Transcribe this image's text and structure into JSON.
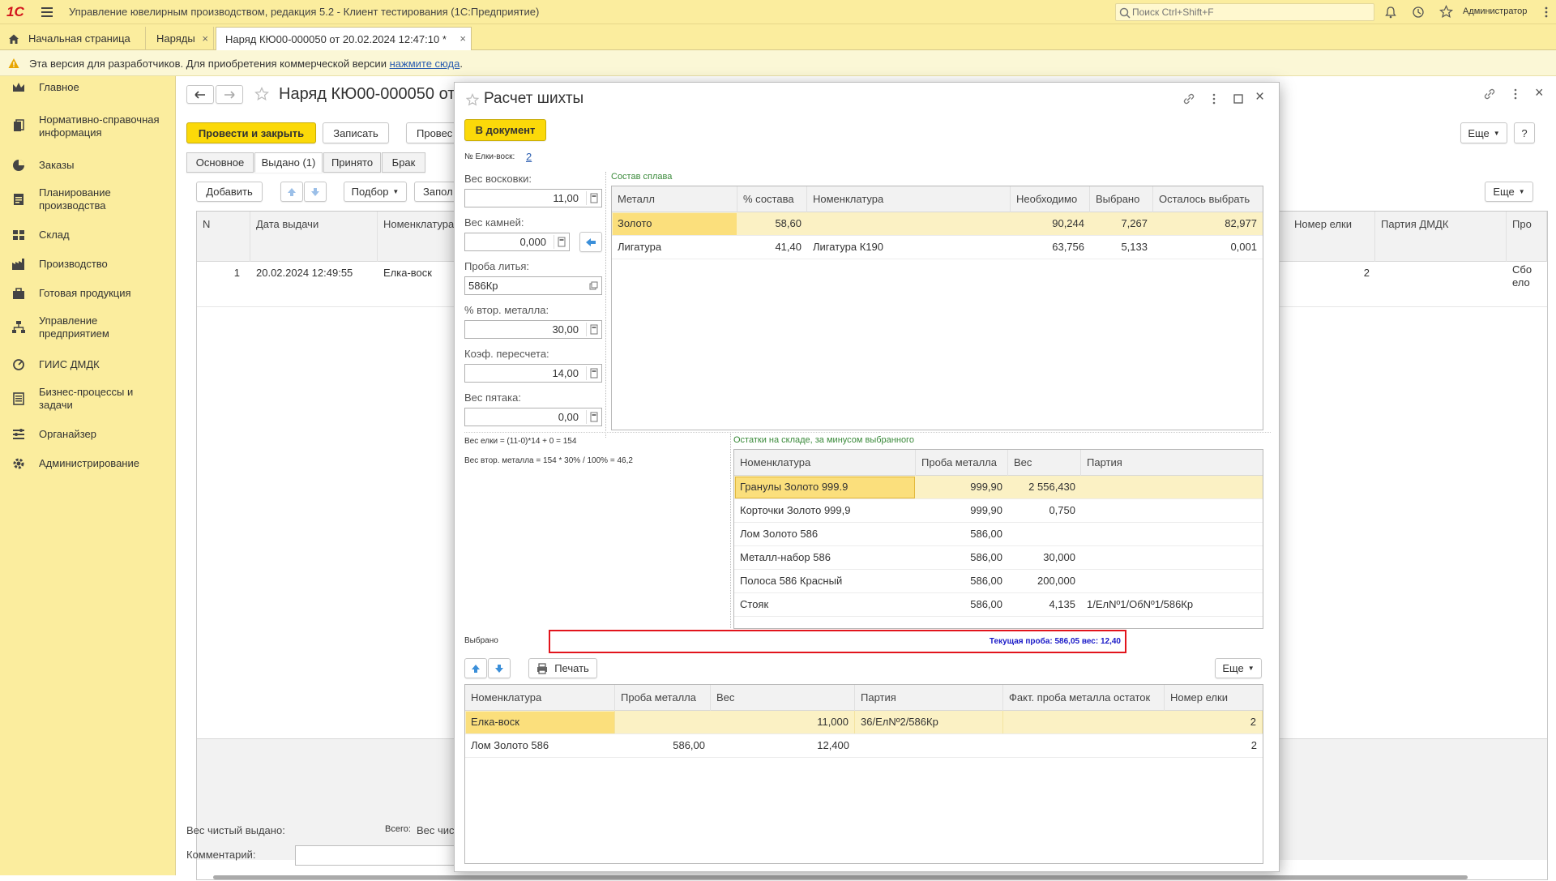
{
  "app": {
    "title": "Управление ювелирным производством, редакция 5.2 - Клиент тестирования (1С:Предприятие)",
    "logo": "1С",
    "search_placeholder": "Поиск Ctrl+Shift+F",
    "user": "Администратор"
  },
  "tabs": [
    {
      "label": "Начальная страница"
    },
    {
      "label": "Наряды"
    },
    {
      "label": "Наряд КЮ00-000050 от 20.02.2024 12:47:10 *"
    }
  ],
  "warning": {
    "text": "Эта версия для разработчиков. Для приобретения коммерческой версии",
    "link": "нажмите сюда",
    "dot": "."
  },
  "sidebar": {
    "items": [
      {
        "label": "Главное"
      },
      {
        "label": "Нормативно-справочная информация"
      },
      {
        "label": "Заказы"
      },
      {
        "label": "Планирование производства"
      },
      {
        "label": "Склад"
      },
      {
        "label": "Производство"
      },
      {
        "label": "Готовая продукция"
      },
      {
        "label": "Управление предприятием"
      },
      {
        "label": "ГИИС ДМДК"
      },
      {
        "label": "Бизнес-процессы и задачи"
      },
      {
        "label": "Органайзер"
      },
      {
        "label": "Администрирование"
      }
    ]
  },
  "doc": {
    "title": "Наряд КЮ00-000050 от 2",
    "btn_post_close": "Провести и закрыть",
    "btn_save": "Записать",
    "btn_post": "Провес",
    "btn_more": "Еще",
    "btn_help": "?",
    "subtabs": [
      "Основное",
      "Выдано (1)",
      "Принято",
      "Брак"
    ],
    "btn_add": "Добавить",
    "btn_select": "Подбор",
    "btn_fill": "Запол",
    "btn_more2": "Еще",
    "columns": [
      "N",
      "Дата выдачи",
      "Номенклатура",
      "Номер елки",
      "Партия ДМДК",
      "Про"
    ],
    "row": {
      "n": "1",
      "date": "20.02.2024 12:49:55",
      "nom": "Елка-воск",
      "tree": "2",
      "extra": "Сбо\nело"
    },
    "total_label": "Всего:",
    "net_weight_label": "Вес чистый выдано:",
    "net_weight_label2": "Вес чис",
    "comment_label": "Комментарий:"
  },
  "modal": {
    "title": "Расчет шихты",
    "btn_to_doc": "В документ",
    "trees_label": "№ Елки-воск:",
    "trees_value": "2",
    "fields": [
      {
        "label": "Вес восковки:",
        "value": "11,00"
      },
      {
        "label": "Вес камней:",
        "value": "0,000"
      },
      {
        "label": "Проба литья:",
        "value": "586Кр"
      },
      {
        "label": "% втор. металла:",
        "value": "30,00"
      },
      {
        "label": "Коэф. пересчета:",
        "value": "14,00"
      },
      {
        "label": "Вес пятака:",
        "value": "0,00"
      }
    ],
    "formula1": "Вес елки = (11-0)*14 + 0 = 154",
    "formula2": "Вес втор. металла = 154 * 30% / 100% = 46,2",
    "alloy_title": "Состав сплава",
    "alloy_columns": [
      "Металл",
      "% состава",
      "Номенклатура",
      "Необходимо",
      "Выбрано",
      "Осталось выбрать"
    ],
    "alloy_rows": [
      [
        "Золото",
        "58,60",
        "",
        "90,244",
        "7,267",
        "82,977"
      ],
      [
        "Лигатура",
        "41,40",
        "Лигатура К190",
        "63,756",
        "5,133",
        "0,001"
      ]
    ],
    "stock_title": "Остатки на складе, за минусом выбранного",
    "stock_columns": [
      "Номенклатура",
      "Проба металла",
      "Вес",
      "Партия"
    ],
    "stock_rows": [
      [
        "Гранулы Золото 999.9",
        "999,90",
        "2 556,430",
        ""
      ],
      [
        "Корточки Золото 999,9",
        "999,90",
        "0,750",
        ""
      ],
      [
        "Лом Золото  586",
        "586,00",
        "",
        ""
      ],
      [
        "Металл-набор 586",
        "586,00",
        "30,000",
        ""
      ],
      [
        "Полоса 586 Красный",
        "586,00",
        "200,000",
        ""
      ],
      [
        "Стояк",
        "586,00",
        "4,135",
        "1/ЕлNº1/ОбNº1/586Кр"
      ]
    ],
    "selected_label": "Выбрано",
    "status": "Текущая проба: 586,05 вес: 12,40",
    "btn_print": "Печать",
    "btn_more": "Еще",
    "sel_columns": [
      "Номенклатура",
      "Проба металла",
      "Вес",
      "Партия",
      "Факт. проба металла остаток",
      "Номер елки"
    ],
    "sel_rows": [
      [
        "Елка-воск",
        "",
        "11,000",
        "36/ЕлNº2/586Кр",
        "",
        "2"
      ],
      [
        "Лом Золото  586",
        "586,00",
        "12,400",
        "",
        "",
        "2"
      ]
    ]
  },
  "colors": {
    "accent_yellow": "#fbd909",
    "bar_yellow": "#fbed9e",
    "highlight": "#fbecaa",
    "status_red": "#e2141c",
    "status_blue": "#1a1ac8",
    "link_blue": "#2a5db0"
  }
}
